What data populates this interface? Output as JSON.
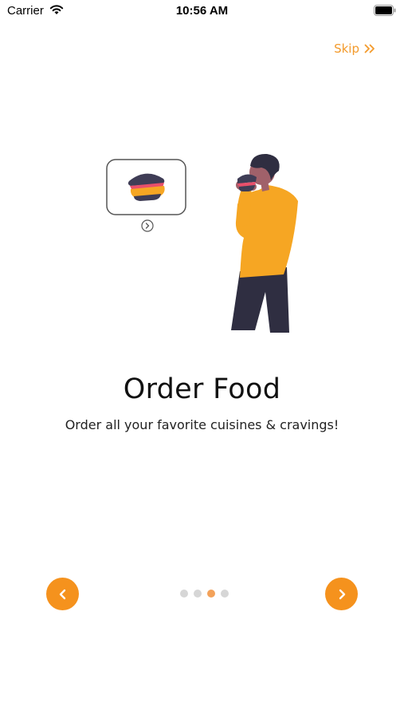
{
  "status_bar": {
    "carrier": "Carrier",
    "time": "10:56 AM"
  },
  "header": {
    "skip_label": "Skip"
  },
  "slide": {
    "title": "Order Food",
    "subtitle": "Order all your favorite cuisines & cravings!",
    "illustration": "person-eating-burger"
  },
  "pagination": {
    "total": 4,
    "active_index": 2
  },
  "colors": {
    "accent": "#F5921D",
    "dot_inactive": "#D6D6D6",
    "dot_active": "#F3A25A",
    "sweater": "#F6A623",
    "pants": "#2F2E41"
  },
  "icons": {
    "prev": "chevron-left-icon",
    "next": "chevron-right-icon",
    "skip": "double-chevron-right-icon"
  }
}
